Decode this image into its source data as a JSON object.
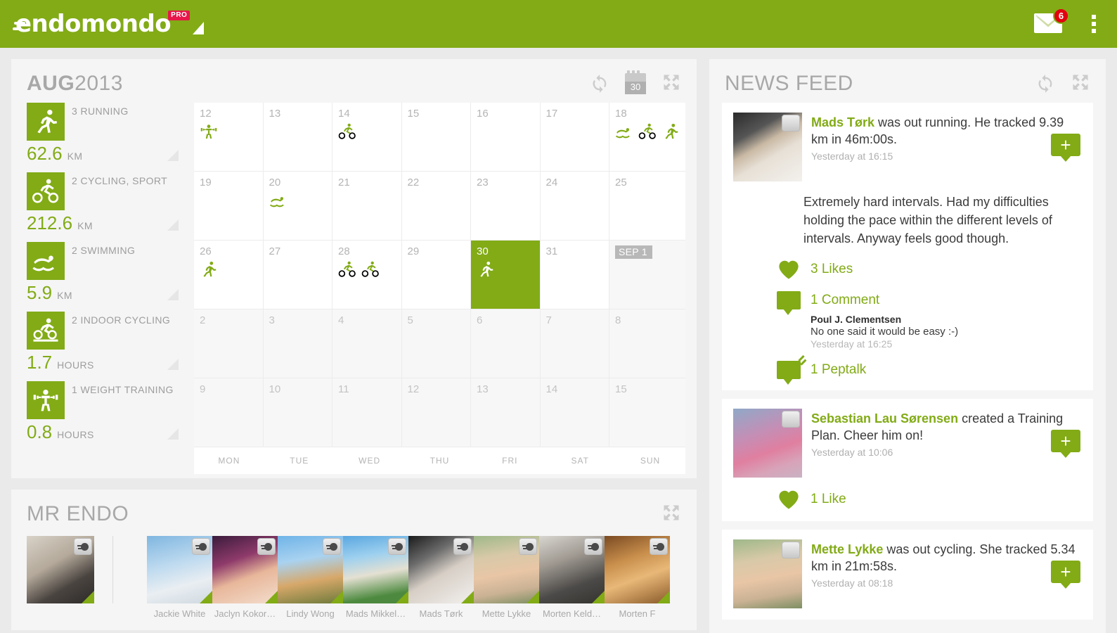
{
  "header": {
    "logo_text": "endomondo",
    "pro_badge": "PRO",
    "mail_badge_count": "6",
    "accent_green": "#82ab16",
    "badge_red": "#e3000f"
  },
  "calendar": {
    "title_month": "AUG",
    "title_year": "2013",
    "icons": {
      "refresh": "refresh-icon",
      "calendar_num": "30",
      "expand": "expand-icon"
    },
    "stats": [
      {
        "label": "3 RUNNING",
        "value": "62.6",
        "unit": "KM",
        "icon": "running-icon"
      },
      {
        "label": "2 CYCLING, SPORT",
        "value": "212.6",
        "unit": "KM",
        "icon": "cycling-icon"
      },
      {
        "label": "2 SWIMMING",
        "value": "5.9",
        "unit": "KM",
        "icon": "swimming-icon"
      },
      {
        "label": "2 INDOOR CYCLING",
        "value": "1.7",
        "unit": "HOURS",
        "icon": "indoor-cycling-icon"
      },
      {
        "label": "1 WEIGHT TRAINING",
        "value": "0.8",
        "unit": "HOURS",
        "icon": "weight-training-icon"
      }
    ],
    "daynames": [
      "MON",
      "TUE",
      "WED",
      "THU",
      "FRI",
      "SAT",
      "SUN"
    ],
    "cells": [
      {
        "day": "12",
        "acts": [
          "weights"
        ]
      },
      {
        "day": "13",
        "acts": []
      },
      {
        "day": "14",
        "acts": [
          "bike"
        ]
      },
      {
        "day": "15",
        "acts": []
      },
      {
        "day": "16",
        "acts": []
      },
      {
        "day": "17",
        "acts": []
      },
      {
        "day": "18",
        "acts": [
          "swim",
          "bike",
          "run"
        ]
      },
      {
        "day": "19",
        "acts": []
      },
      {
        "day": "20",
        "acts": [
          "swim"
        ]
      },
      {
        "day": "21",
        "acts": []
      },
      {
        "day": "22",
        "acts": []
      },
      {
        "day": "23",
        "acts": []
      },
      {
        "day": "24",
        "acts": []
      },
      {
        "day": "25",
        "acts": []
      },
      {
        "day": "26",
        "acts": [
          "run"
        ]
      },
      {
        "day": "27",
        "acts": []
      },
      {
        "day": "28",
        "acts": [
          "bike",
          "bike"
        ]
      },
      {
        "day": "29",
        "acts": []
      },
      {
        "day": "30",
        "acts": [
          "run"
        ],
        "today": true
      },
      {
        "day": "31",
        "acts": []
      },
      {
        "day": "SEP 1",
        "acts": [],
        "other": true,
        "badge": true
      },
      {
        "day": "2",
        "acts": [],
        "other": true
      },
      {
        "day": "3",
        "acts": [],
        "other": true
      },
      {
        "day": "4",
        "acts": [],
        "other": true
      },
      {
        "day": "5",
        "acts": [],
        "other": true
      },
      {
        "day": "6",
        "acts": [],
        "other": true
      },
      {
        "day": "7",
        "acts": [],
        "other": true
      },
      {
        "day": "8",
        "acts": [],
        "other": true
      },
      {
        "day": "9",
        "acts": [],
        "other": true
      },
      {
        "day": "10",
        "acts": [],
        "other": true
      },
      {
        "day": "11",
        "acts": [],
        "other": true
      },
      {
        "day": "12",
        "acts": [],
        "other": true
      },
      {
        "day": "13",
        "acts": [],
        "other": true
      },
      {
        "day": "14",
        "acts": [],
        "other": true
      },
      {
        "day": "15",
        "acts": [],
        "other": true
      }
    ]
  },
  "mrendo": {
    "title": "MR ENDO",
    "expand_icon": "expand-icon",
    "self_photo": "mr-endo-photo",
    "friends": [
      {
        "name": "Jackie White",
        "photo": "ph-f1"
      },
      {
        "name": "Jaclyn Kokor…",
        "photo": "ph-f2"
      },
      {
        "name": "Lindy Wong",
        "photo": "ph-f3"
      },
      {
        "name": "Mads Mikkel…",
        "photo": "ph-f4"
      },
      {
        "name": "Mads Tørk",
        "photo": "ph-f5"
      },
      {
        "name": "Mette Lykke",
        "photo": "ph-f6"
      },
      {
        "name": "Morten Keld…",
        "photo": "ph-f7"
      },
      {
        "name": "Morten F",
        "photo": "ph-f8"
      }
    ]
  },
  "newsfeed": {
    "title": "NEWS FEED",
    "icons": {
      "refresh": "refresh-icon",
      "expand": "expand-icon"
    },
    "posts": [
      {
        "author": "Mads Tørk",
        "rest": " was out running. He tracked 9.39 km in 46m:00s.",
        "time": "Yesterday at 16:15",
        "body": "Extremely hard intervals. Had my difficulties holding the pace within the different levels of intervals. Anyway feels good though.",
        "likes": "3 Likes",
        "comments": "1 Comment",
        "comment_author": "Poul J. Clementsen",
        "comment_text": "No one said it would be easy :-)",
        "comment_time": "Yesterday at 16:25",
        "peptalk": "1 Peptalk",
        "photo": "ph-mads",
        "plus_label": "+"
      },
      {
        "author": "Sebastian Lau Sørensen",
        "rest": " created a Training Plan. Cheer him on!",
        "time": "Yesterday at 10:06",
        "likes": "1 Like",
        "photo": "ph-seb",
        "plus_label": "+"
      },
      {
        "author": "Mette Lykke",
        "rest": " was out cycling. She tracked 5.34 km in 21m:58s.",
        "time": "Yesterday at 08:18",
        "photo": "ph-mette",
        "plus_label": "+"
      }
    ]
  }
}
